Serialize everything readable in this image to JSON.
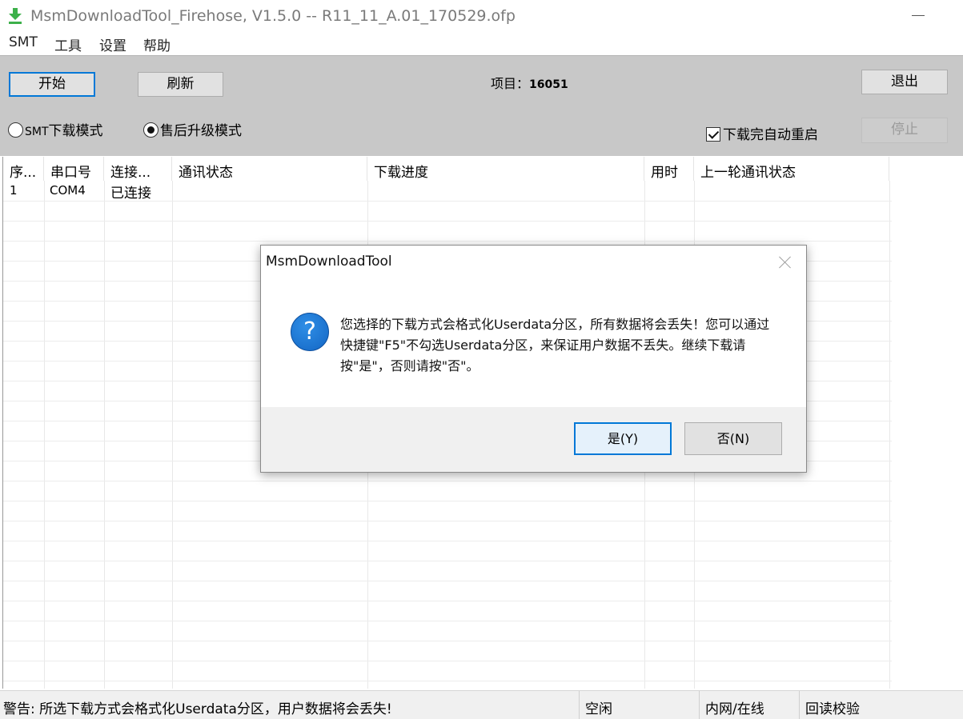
{
  "window": {
    "title": "MsmDownloadTool_Firehose, V1.5.0 -- R11_11_A.01_170529.ofp",
    "icon": "download-arrow-icon",
    "minimize": "minimize-icon"
  },
  "menu": {
    "items": [
      {
        "label": "SMT"
      },
      {
        "label": "工具"
      },
      {
        "label": "设置"
      },
      {
        "label": "帮助"
      }
    ]
  },
  "toolbar": {
    "start_label": "开始",
    "refresh_label": "刷新",
    "project_label": "项目：",
    "project_value": "16051",
    "exit_label": "退出",
    "stop_label": "停止",
    "mode_smt_prefix": "SMT",
    "mode_smt_label": "下载模式",
    "mode_aftersales_label": "售后升级模式",
    "selected_mode": "售后升级模式",
    "auto_restart_label": "下载完自动重启",
    "auto_restart_checked": true
  },
  "grid": {
    "columns": [
      {
        "label": "序..."
      },
      {
        "label": "串口号"
      },
      {
        "label": "连接..."
      },
      {
        "label": "通讯状态"
      },
      {
        "label": "下载进度"
      },
      {
        "label": "用时"
      },
      {
        "label": "上一轮通讯状态"
      }
    ],
    "rows": [
      {
        "index": "1",
        "port": "COM4",
        "connection": "已连接",
        "comm_status": "",
        "progress": "",
        "time": "",
        "last_status": ""
      }
    ]
  },
  "statusbar": {
    "warning": "警告: 所选下载方式会格式化Userdata分区，用户数据将会丢失!",
    "state": "空闲",
    "network": "内网/在线",
    "verify": "回读校验"
  },
  "dialog": {
    "title": "MsmDownloadTool",
    "message": "您选择的下载方式会格式化Userdata分区，所有数据将会丢失！您可以通过快捷键\"F5\"不勾选Userdata分区，来保证用户数据不丢失。继续下载请按\"是\"，否则请按\"否\"。",
    "icon_glyph": "?",
    "yes_label": "是(Y)",
    "no_label": "否(N)"
  },
  "colors": {
    "accent": "#0078d7",
    "app_icon": "#3cb04a",
    "panel": "#c8c8c8"
  }
}
